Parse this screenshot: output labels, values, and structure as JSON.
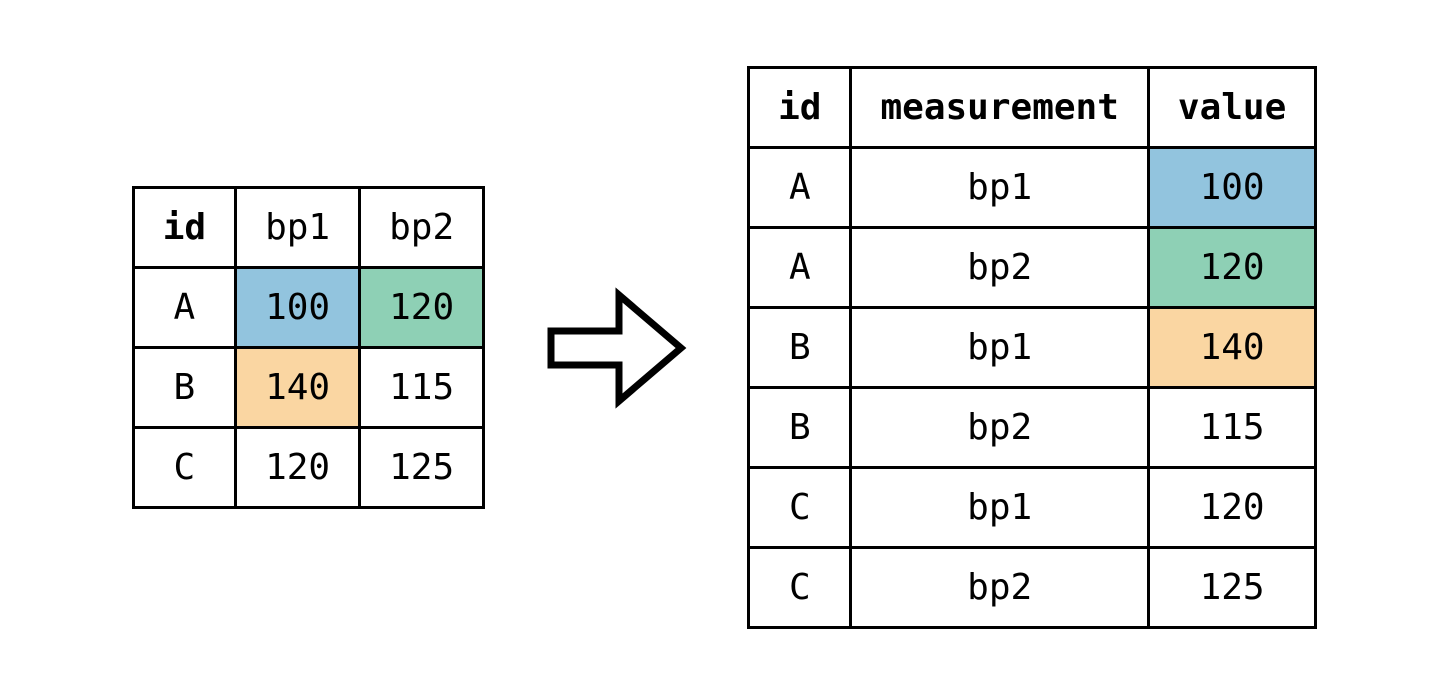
{
  "colors": {
    "blue": "#92c4de",
    "green": "#8ed0b5",
    "orange": "#fad6a2"
  },
  "wide": {
    "headers": {
      "id": "id",
      "bp1": "bp1",
      "bp2": "bp2"
    },
    "rows": [
      {
        "id": "A",
        "bp1": "100",
        "bp2": "120",
        "bp1_color": "blue",
        "bp2_color": "green"
      },
      {
        "id": "B",
        "bp1": "140",
        "bp2": "115",
        "bp1_color": "orange",
        "bp2_color": ""
      },
      {
        "id": "C",
        "bp1": "120",
        "bp2": "125",
        "bp1_color": "",
        "bp2_color": ""
      }
    ]
  },
  "long": {
    "headers": {
      "id": "id",
      "measurement": "measurement",
      "value": "value"
    },
    "rows": [
      {
        "id": "A",
        "measurement": "bp1",
        "value": "100",
        "value_color": "blue"
      },
      {
        "id": "A",
        "measurement": "bp2",
        "value": "120",
        "value_color": "green"
      },
      {
        "id": "B",
        "measurement": "bp1",
        "value": "140",
        "value_color": "orange"
      },
      {
        "id": "B",
        "measurement": "bp2",
        "value": "115",
        "value_color": ""
      },
      {
        "id": "C",
        "measurement": "bp1",
        "value": "120",
        "value_color": ""
      },
      {
        "id": "C",
        "measurement": "bp2",
        "value": "125",
        "value_color": ""
      }
    ]
  }
}
